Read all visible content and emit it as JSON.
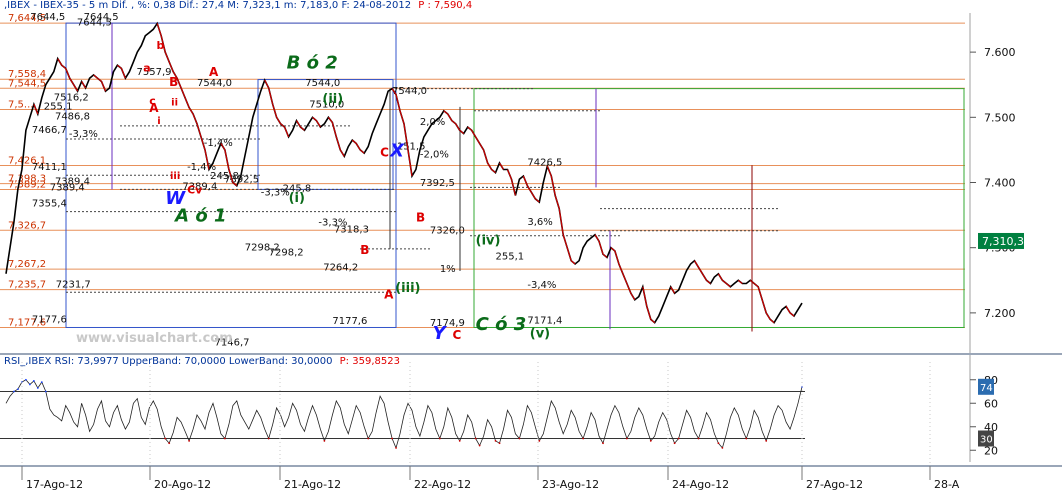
{
  "header": {
    "text": ",IBEX - IBEX-35 -  5 m Dif. , %: 0,38 Dif.: 27,4 M: 7,323,1 m: 7,183,0 F: 24-08-2012",
    "last": "P : 7,590,4",
    "text_color": "#003399",
    "last_color": "#e00000"
  },
  "rsi_header": {
    "text": "RSI_,IBEX RSI: 73,9977 UpperBand: 70,0000 LowerBand: 30,0000",
    "last": "P: 359,8523"
  },
  "watermark": "www.visualchart.com",
  "colors": {
    "background": "#ffffff",
    "price_line": "#000000",
    "price_down": "#cc0000",
    "fib_line": "#e8905a",
    "right_axis_bg": "#ffffff",
    "price_tag_bg": "#008040",
    "rsi_tag_bg": "#2b6cb0",
    "wave_green": "#0b6b1a",
    "wave_blue": "#1a1aff",
    "wave_red": "#dd0000",
    "purple": "#6a2dbf",
    "maroon": "#8b0000"
  },
  "chart_data": [
    {
      "type": "line",
      "title": "IBEX-35 5 m",
      "ylim": [
        7140,
        7660
      ],
      "y_ticks": [
        "7.600",
        "7.500",
        "7.400",
        "7.300",
        "7.200"
      ],
      "y_tick_values": [
        7600,
        7500,
        7400,
        7300,
        7200
      ],
      "x_tick_labels": [
        "17-Ago-12",
        "20-Ago-12",
        "21-Ago-12",
        "22-Ago-12",
        "23-Ago-12",
        "24-Ago-12",
        "27-Ago-12",
        "28-A"
      ],
      "last_value_tag": "7,310,3",
      "last_value": 7310.3,
      "x": [
        0,
        0.005,
        0.01,
        0.015,
        0.02,
        0.025,
        0.03,
        0.035,
        0.04,
        0.045,
        0.05,
        0.055,
        0.06,
        0.065,
        0.07,
        0.075,
        0.08,
        0.085,
        0.09,
        0.095,
        0.1,
        0.105,
        0.11,
        0.115,
        0.12,
        0.125,
        0.13,
        0.135,
        0.14,
        0.145,
        0.15,
        0.155,
        0.16,
        0.165,
        0.17,
        0.175,
        0.18,
        0.185,
        0.19,
        0.195,
        0.2,
        0.205,
        0.21,
        0.215,
        0.22,
        0.225,
        0.23,
        0.235,
        0.24,
        0.245,
        0.25,
        0.255,
        0.26,
        0.265,
        0.27,
        0.275,
        0.28,
        0.285,
        0.29,
        0.295,
        0.3,
        0.305,
        0.31,
        0.315,
        0.32,
        0.325,
        0.33,
        0.335,
        0.34,
        0.345,
        0.35,
        0.355,
        0.36,
        0.365,
        0.37,
        0.375,
        0.38,
        0.385,
        0.39,
        0.395,
        0.4,
        0.405,
        0.41,
        0.415,
        0.42,
        0.425,
        0.43,
        0.435,
        0.44,
        0.445,
        0.45,
        0.455,
        0.46,
        0.465,
        0.47,
        0.475,
        0.48,
        0.485,
        0.49,
        0.495,
        0.5,
        0.505,
        0.51,
        0.515,
        0.52,
        0.525,
        0.53,
        0.535,
        0.54,
        0.545,
        0.55,
        0.555,
        0.56,
        0.565,
        0.57,
        0.575,
        0.58,
        0.585,
        0.59,
        0.595,
        0.6,
        0.605,
        0.61,
        0.615,
        0.62,
        0.625,
        0.63,
        0.635,
        0.64,
        0.645,
        0.65,
        0.655,
        0.66,
        0.665,
        0.67,
        0.675,
        0.68,
        0.685,
        0.69,
        0.695,
        0.7,
        0.705,
        0.71,
        0.715,
        0.72,
        0.725,
        0.73,
        0.735,
        0.74,
        0.745,
        0.75,
        0.755,
        0.76,
        0.765,
        0.77,
        0.775,
        0.78,
        0.785,
        0.79,
        0.795,
        0.8,
        0.805,
        0.81,
        0.815,
        0.82,
        0.825,
        0.83,
        0.835,
        0.84,
        0.845,
        0.85,
        0.855,
        0.86,
        0.865,
        0.87,
        0.875,
        0.88,
        0.885,
        0.89,
        0.895,
        0.9,
        0.905,
        0.91,
        0.915,
        0.92,
        0.925,
        0.93,
        0.935,
        0.94,
        0.945,
        0.95,
        0.955,
        0.96,
        0.965,
        0.97,
        0.975,
        0.98,
        0.985,
        0.99,
        0.995,
        1.0
      ],
      "series": [
        {
          "values": [
            7260,
            7300,
            7340,
            7390,
            7420,
            7480,
            7500,
            7520,
            7505,
            7530,
            7550,
            7560,
            7570,
            7590,
            7580,
            7575,
            7560,
            7550,
            7540,
            7555,
            7545,
            7560,
            7565,
            7560,
            7555,
            7540,
            7545,
            7570,
            7580,
            7575,
            7560,
            7570,
            7585,
            7600,
            7610,
            7625,
            7630,
            7635,
            7644,
            7625,
            7600,
            7585,
            7570,
            7560,
            7545,
            7530,
            7515,
            7505,
            7490,
            7470,
            7450,
            7420,
            7430,
            7445,
            7460,
            7450,
            7420,
            7400,
            7395,
            7410,
            7440,
            7470,
            7500,
            7520,
            7540,
            7557,
            7545,
            7520,
            7500,
            7490,
            7485,
            7470,
            7480,
            7495,
            7485,
            7480,
            7490,
            7500,
            7495,
            7485,
            7490,
            7500,
            7492,
            7470,
            7450,
            7440,
            7455,
            7465,
            7460,
            7450,
            7445,
            7455,
            7475,
            7490,
            7505,
            7520,
            7540,
            7544,
            7535,
            7510,
            7490,
            7450,
            7410,
            7420,
            7450,
            7470,
            7480,
            7490,
            7495,
            7500,
            7510,
            7505,
            7495,
            7490,
            7480,
            7475,
            7485,
            7480,
            7470,
            7460,
            7450,
            7430,
            7420,
            7415,
            7430,
            7420,
            7420,
            7405,
            7380,
            7405,
            7410,
            7395,
            7385,
            7375,
            7370,
            7400,
            7425,
            7410,
            7380,
            7360,
            7320,
            7300,
            7280,
            7275,
            7280,
            7300,
            7310,
            7315,
            7320,
            7310,
            7290,
            7285,
            7300,
            7295,
            7275,
            7260,
            7245,
            7230,
            7220,
            7225,
            7240,
            7210,
            7190,
            7185,
            7195,
            7210,
            7225,
            7240,
            7230,
            7235,
            7250,
            7265,
            7275,
            7280,
            7270,
            7260,
            7250,
            7245,
            7255,
            7260,
            7250,
            7245,
            7240,
            7245,
            7250,
            7245,
            7245,
            7250,
            7245,
            7240,
            7220,
            7200,
            7190,
            7185,
            7195,
            7205,
            7210,
            7200,
            7195,
            7205,
            7215,
            7230,
            7245,
            7260,
            7300,
            7310
          ]
        }
      ]
    },
    {
      "type": "line",
      "title": "RSI",
      "ylim": [
        10,
        90
      ],
      "y_ticks": [
        "80",
        "60",
        "40",
        "20"
      ],
      "upper_band": 70,
      "lower_band": 30,
      "last_value_tag": "74",
      "lower_tag": "30",
      "series": [
        {
          "values": [
            60,
            66,
            70,
            72,
            78,
            80,
            76,
            79,
            73,
            78,
            70,
            55,
            50,
            48,
            45,
            58,
            52,
            44,
            40,
            60,
            50,
            36,
            42,
            55,
            62,
            45,
            40,
            52,
            58,
            46,
            38,
            44,
            60,
            64,
            48,
            42,
            56,
            62,
            55,
            40,
            30,
            26,
            35,
            48,
            44,
            36,
            28,
            38,
            50,
            45,
            38,
            52,
            60,
            48,
            34,
            30,
            42,
            58,
            62,
            50,
            44,
            38,
            46,
            54,
            48,
            38,
            30,
            42,
            56,
            50,
            40,
            48,
            60,
            54,
            42,
            36,
            48,
            58,
            50,
            38,
            28,
            36,
            50,
            62,
            56,
            42,
            34,
            46,
            58,
            52,
            40,
            30,
            36,
            52,
            66,
            60,
            44,
            30,
            22,
            34,
            50,
            60,
            54,
            40,
            32,
            44,
            58,
            52,
            38,
            30,
            40,
            56,
            48,
            34,
            28,
            36,
            50,
            44,
            30,
            24,
            32,
            46,
            40,
            28,
            26,
            38,
            54,
            48,
            34,
            30,
            42,
            58,
            52,
            40,
            28,
            34,
            48,
            62,
            56,
            44,
            34,
            42,
            54,
            48,
            36,
            30,
            40,
            52,
            46,
            32,
            26,
            38,
            50,
            58,
            52,
            40,
            30,
            36,
            48,
            56,
            50,
            38,
            28,
            32,
            44,
            52,
            46,
            34,
            26,
            30,
            42,
            54,
            48,
            36,
            30,
            40,
            52,
            46,
            34,
            26,
            22,
            34,
            48,
            56,
            50,
            38,
            30,
            40,
            54,
            48,
            36,
            28,
            38,
            50,
            58,
            54,
            44,
            38,
            48,
            60,
            74
          ]
        }
      ]
    }
  ],
  "fib_levels": [
    {
      "label": "7,644,5",
      "value": 7644.5
    },
    {
      "label": "7,558,4",
      "value": 7558.4
    },
    {
      "label": "7,544,5",
      "value": 7544.5
    },
    {
      "label": "7,5...",
      "value": 7512
    },
    {
      "label": "7,426,1",
      "value": 7426.1
    },
    {
      "label": "7,398,3",
      "value": 7398.3
    },
    {
      "label": "7,389,2",
      "value": 7389.2
    },
    {
      "label": "7,326,7",
      "value": 7326.7
    },
    {
      "label": "7,267,2",
      "value": 7267.2
    },
    {
      "label": "7,235,7",
      "value": 7235.7
    },
    {
      "label": "7,177,6",
      "value": 7177.6
    }
  ],
  "level_labels": [
    {
      "text": "7644,5",
      "fx": 0.061,
      "value": 7649
    },
    {
      "text": "7644,5",
      "fx": 0.195,
      "value": 7649
    },
    {
      "text": "7644,5",
      "fx": 0.178,
      "value": 7641
    },
    {
      "text": "7557,9",
      "fx": 0.328,
      "value": 7565
    },
    {
      "text": "7544,0",
      "fx": 0.48,
      "value": 7548
    },
    {
      "text": "7544,0",
      "fx": 0.752,
      "value": 7548
    },
    {
      "text": "7544,0",
      "fx": 0.97,
      "value": 7536
    },
    {
      "text": "255,1",
      "fx": 0.095,
      "value": 7512
    },
    {
      "text": "7516,2",
      "fx": 0.12,
      "value": 7526
    },
    {
      "text": "7486,8",
      "fx": 0.123,
      "value": 7497
    },
    {
      "text": "7466,7",
      "fx": 0.065,
      "value": 7476
    },
    {
      "text": "-3,3%",
      "fx": 0.158,
      "value": 7470
    },
    {
      "text": "7411,1",
      "fx": 0.065,
      "value": 7419
    },
    {
      "text": "7389,4",
      "fx": 0.123,
      "value": 7397
    },
    {
      "text": "7389,4",
      "fx": 0.11,
      "value": 7388
    },
    {
      "text": "7355,4",
      "fx": 0.065,
      "value": 7363
    },
    {
      "text": "7231,7",
      "fx": 0.125,
      "value": 7239
    },
    {
      "text": "7177,6",
      "fx": 0.065,
      "value": 7185
    },
    {
      "text": "7146,7",
      "fx": 0.524,
      "value": 7150
    },
    {
      "text": "7510,0",
      "fx": 0.762,
      "value": 7515
    },
    {
      "text": "7392,5",
      "fx": 0.548,
      "value": 7400
    },
    {
      "text": "7389,4",
      "fx": 0.443,
      "value": 7389
    },
    {
      "text": "245,8",
      "fx": 0.513,
      "value": 7405
    },
    {
      "text": "-1,4%",
      "fx": 0.455,
      "value": 7419
    },
    {
      "text": "-1,4%",
      "fx": 0.497,
      "value": 7456
    },
    {
      "text": "-3,3%",
      "fx": 0.64,
      "value": 7380
    },
    {
      "text": "245,8",
      "fx": 0.695,
      "value": 7386
    },
    {
      "text": "7298,2",
      "fx": 0.66,
      "value": 7288
    },
    {
      "text": "7298,2",
      "fx": 0.6,
      "value": 7296
    },
    {
      "text": "7264,2",
      "fx": 0.797,
      "value": 7265
    },
    {
      "text": "7177,6",
      "fx": 0.82,
      "value": 7183
    },
    {
      "text": "7318,3",
      "fx": 0.824,
      "value": 7323
    },
    {
      "text": "-3,3%",
      "fx": 0.785,
      "value": 7334
    },
    {
      "text": "7326,0",
      "fx": 1.065,
      "value": 7322
    },
    {
      "text": "7174,9",
      "fx": 1.065,
      "value": 7180
    },
    {
      "text": "7426,5",
      "fx": 1.31,
      "value": 7426
    },
    {
      "text": "3,6%",
      "fx": 1.31,
      "value": 7335
    },
    {
      "text": "-3,4%",
      "fx": 1.31,
      "value": 7238
    },
    {
      "text": "7171,4",
      "fx": 1.31,
      "value": 7184
    },
    {
      "text": "255,1",
      "fx": 1.23,
      "value": 7282
    },
    {
      "text": "7392,5",
      "fx": 1.04,
      "value": 7395
    },
    {
      "text": "2,0%",
      "fx": 1.04,
      "value": 7488
    },
    {
      "text": "-2,0%",
      "fx": 1.04,
      "value": 7438
    },
    {
      "text": "151,5",
      "fx": 0.982,
      "value": 7451
    },
    {
      "text": "1%",
      "fx": 1.09,
      "value": 7263
    }
  ],
  "wave_labels": [
    {
      "text": "B ó 2",
      "fx": 0.705,
      "value": 7575,
      "color": "green",
      "size": 18
    },
    {
      "text": "A ó 1",
      "fx": 0.425,
      "value": 7340,
      "color": "green",
      "size": 18
    },
    {
      "text": "C ó 3",
      "fx": 1.18,
      "value": 7174,
      "color": "green",
      "size": 18
    },
    {
      "text": "W",
      "fx": 0.4,
      "value": 7367,
      "color": "blue",
      "size": 18
    },
    {
      "text": "X",
      "fx": 0.965,
      "value": 7440,
      "color": "blue",
      "size": 18
    },
    {
      "text": "Y",
      "fx": 1.072,
      "value": 7160,
      "color": "blue",
      "size": 18
    },
    {
      "text": "(ii)",
      "fx": 0.795,
      "value": 7522,
      "color": "green",
      "size": 13
    },
    {
      "text": "(i)",
      "fx": 0.71,
      "value": 7370,
      "color": "green",
      "size": 13
    },
    {
      "text": "(iii)",
      "fx": 0.978,
      "value": 7232,
      "color": "green",
      "size": 13
    },
    {
      "text": "(iv)",
      "fx": 1.18,
      "value": 7305,
      "color": "green",
      "size": 13
    },
    {
      "text": "(v)",
      "fx": 1.316,
      "value": 7162,
      "color": "green",
      "size": 13
    },
    {
      "text": "A",
      "fx": 0.51,
      "value": 7563,
      "color": "red",
      "size": 12
    },
    {
      "text": "B",
      "fx": 0.41,
      "value": 7548,
      "color": "red",
      "size": 12
    },
    {
      "text": "A",
      "fx": 0.36,
      "value": 7508,
      "color": "red",
      "size": 12
    },
    {
      "text": "Cv",
      "fx": 0.455,
      "value": 7383,
      "color": "red",
      "size": 11
    },
    {
      "text": "C",
      "fx": 0.94,
      "value": 7440,
      "color": "red",
      "size": 12
    },
    {
      "text": "B",
      "fx": 1.03,
      "value": 7340,
      "color": "red",
      "size": 12
    },
    {
      "text": "B",
      "fx": 0.89,
      "value": 7290,
      "color": "red",
      "size": 12
    },
    {
      "text": "A",
      "fx": 0.95,
      "value": 7222,
      "color": "red",
      "size": 12
    },
    {
      "text": "C",
      "fx": 1.122,
      "value": 7160,
      "color": "red",
      "size": 12
    },
    {
      "text": "a",
      "fx": 0.345,
      "value": 7570,
      "color": "red",
      "size": 11
    },
    {
      "text": "b",
      "fx": 0.378,
      "value": 7605,
      "color": "red",
      "size": 11
    },
    {
      "text": "c",
      "fx": 0.36,
      "value": 7520,
      "color": "red",
      "size": 11
    },
    {
      "text": "ii",
      "fx": 0.415,
      "value": 7518,
      "color": "red",
      "size": 10
    },
    {
      "text": "i",
      "fx": 0.38,
      "value": 7490,
      "color": "red",
      "size": 10
    },
    {
      "text": "iii",
      "fx": 0.412,
      "value": 7405,
      "color": "red",
      "size": 10
    }
  ]
}
